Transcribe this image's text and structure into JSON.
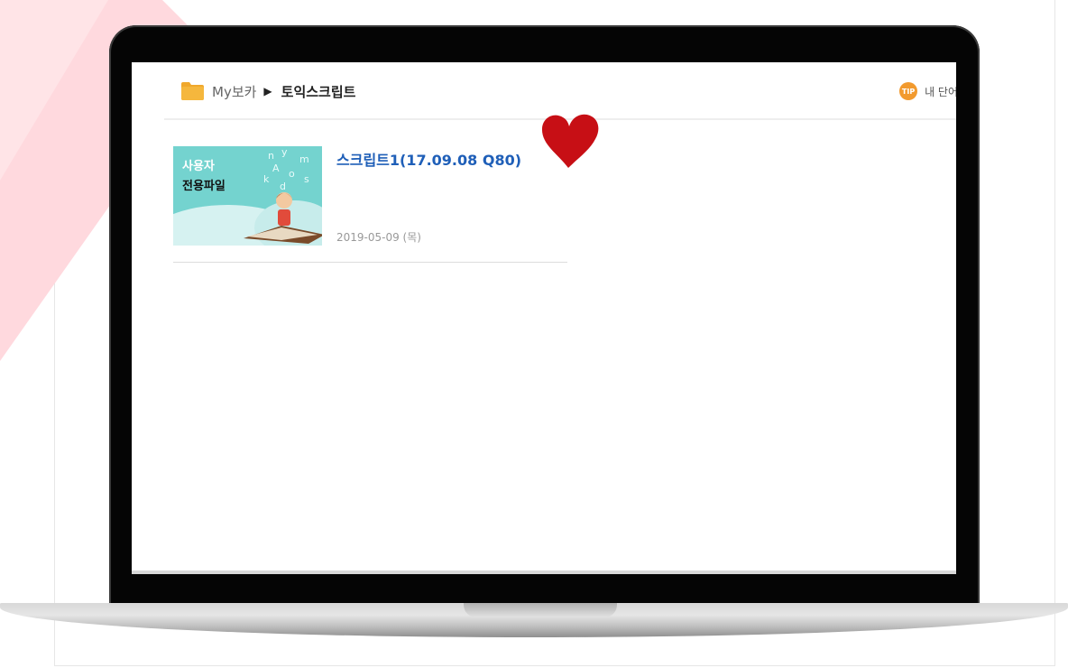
{
  "breadcrumb": {
    "root": "My보카",
    "separator": "▶",
    "current": "토익스크립트"
  },
  "tip": {
    "icon_label": "TIP",
    "text": "내 단어"
  },
  "items": [
    {
      "thumb_line1": "사용자",
      "thumb_line2": "전용파일",
      "title": "스크립트1(17.09.08 Q80)",
      "date": "2019-05-09 (목)"
    }
  ],
  "colors": {
    "title": "#1f5fb8",
    "heart": "#c70f15",
    "folder": "#f0a82c",
    "tip": "#f29a2e",
    "pink": "#ffd7dc"
  }
}
